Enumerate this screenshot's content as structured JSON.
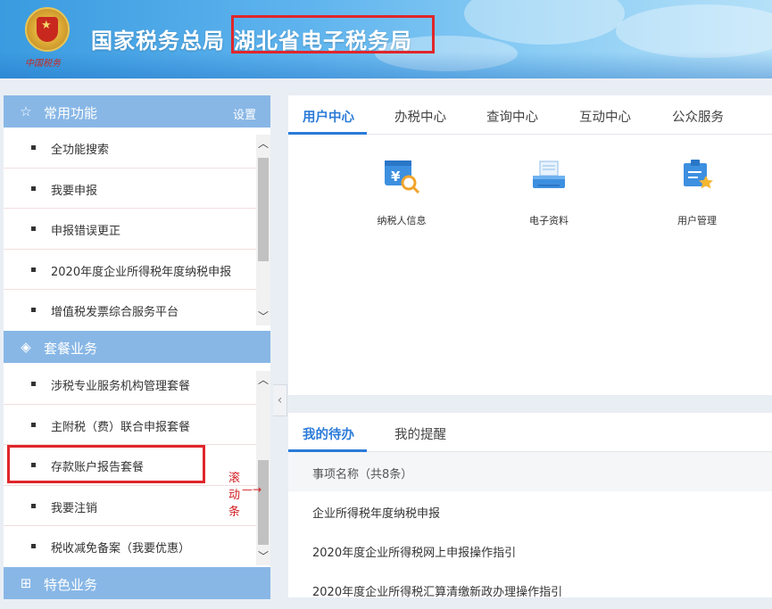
{
  "header": {
    "title_main": "国家税务总局",
    "title_sub": "湖北省电子税务局",
    "emblem_label": "中国税务",
    "highlight_color": "#e0262b"
  },
  "sidebar": {
    "section1": {
      "icon": "star-icon",
      "label": "常用功能",
      "setting": "设置",
      "items": [
        {
          "label": "全功能搜索"
        },
        {
          "label": "我要申报"
        },
        {
          "label": "申报错误更正"
        },
        {
          "label": "2020年度企业所得税年度纳税申报"
        },
        {
          "label": "增值税发票综合服务平台"
        }
      ]
    },
    "section2": {
      "icon": "layers-icon",
      "label": "套餐业务",
      "items": [
        {
          "label": "涉税专业服务机构管理套餐"
        },
        {
          "label": "主附税（费）联合申报套餐"
        },
        {
          "label": "存款账户报告套餐"
        },
        {
          "label": "我要注销"
        },
        {
          "label": "税收减免备案（我要优惠）"
        }
      ]
    },
    "section3": {
      "icon": "grid-icon",
      "label": "特色业务"
    }
  },
  "annotation": {
    "chars": [
      "滚",
      "动",
      "条"
    ],
    "arrow": "—→"
  },
  "top_panel": {
    "tabs": [
      "用户中心",
      "办税中心",
      "查询中心",
      "互动中心",
      "公众服务"
    ],
    "active_tab": 0,
    "apps": [
      {
        "icon": "taxpayer-info-icon",
        "label": "纳税人信息"
      },
      {
        "icon": "electronic-data-icon",
        "label": "电子资料"
      },
      {
        "icon": "user-management-icon",
        "label": "用户管理"
      }
    ]
  },
  "bottom_panel": {
    "tabs": [
      "我的待办",
      "我的提醒"
    ],
    "active_tab": 0,
    "header": "事项名称（共8条）",
    "rows": [
      "企业所得税年度纳税申报",
      "2020年度企业所得税网上申报操作指引",
      "2020年度企业所得税汇算清缴新政办理操作指引"
    ]
  },
  "colors": {
    "accent": "#2b7bd8",
    "section_header": "#88b7e6",
    "annotation_red": "#d21f23"
  }
}
